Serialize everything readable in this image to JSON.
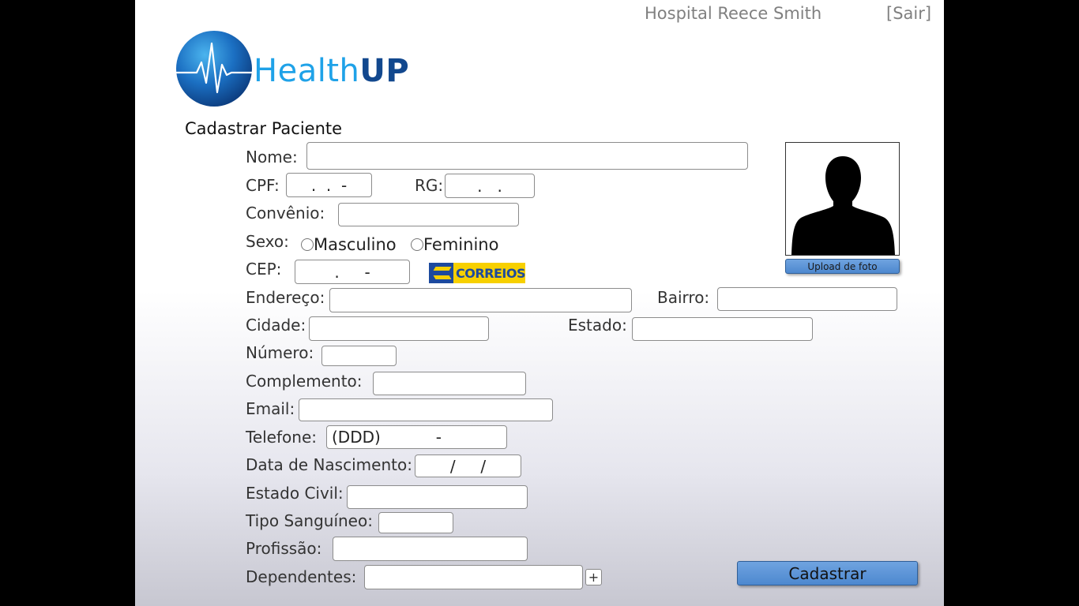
{
  "header": {
    "hospital_name": "Hospital Reece Smith",
    "logout_label": "[Sair]"
  },
  "brand": {
    "name_part1": "Health",
    "name_part2": "UP",
    "color_light": "#1fa2e8",
    "color_dark": "#12488e"
  },
  "form": {
    "title": "Cadastrar Paciente",
    "nome": {
      "label": "Nome:",
      "value": ""
    },
    "cpf": {
      "label": "CPF:",
      "mask": ".  .  -"
    },
    "rg": {
      "label": "RG:",
      "mask": ".   ."
    },
    "convenio": {
      "label": "Convênio:",
      "value": ""
    },
    "sexo": {
      "label": "Sexo:",
      "options": [
        "Masculino",
        "Feminino"
      ]
    },
    "cep": {
      "label": "CEP:",
      "mask": ".     -"
    },
    "correios_label": "CORREIOS",
    "endereco": {
      "label": "Endereço:",
      "value": ""
    },
    "bairro": {
      "label": "Bairro:",
      "value": ""
    },
    "cidade": {
      "label": "Cidade:",
      "value": ""
    },
    "estado": {
      "label": "Estado:",
      "value": ""
    },
    "numero": {
      "label": "Número:",
      "value": ""
    },
    "complemento": {
      "label": "Complemento:",
      "value": ""
    },
    "email": {
      "label": "Email:",
      "value": ""
    },
    "telefone": {
      "label": "Telefone:",
      "mask": "(DDD)           -"
    },
    "nascimento": {
      "label": "Data de Nascimento:",
      "mask": "/     /"
    },
    "estado_civil": {
      "label": "Estado Civil:",
      "value": ""
    },
    "tipo_sanguineo": {
      "label": "Tipo Sanguíneo:",
      "value": ""
    },
    "profissao": {
      "label": "Profissão:",
      "value": ""
    },
    "dependentes": {
      "label": "Dependentes:",
      "value": "",
      "add_label": "+"
    }
  },
  "photo": {
    "upload_label": "Upload de foto",
    "icon": "user-silhouette-icon"
  },
  "actions": {
    "submit_label": "Cadastrar"
  },
  "colors": {
    "button_blue": "#4d88cf",
    "correios_yellow": "#f7d000",
    "correios_blue": "#1d4a9e"
  }
}
